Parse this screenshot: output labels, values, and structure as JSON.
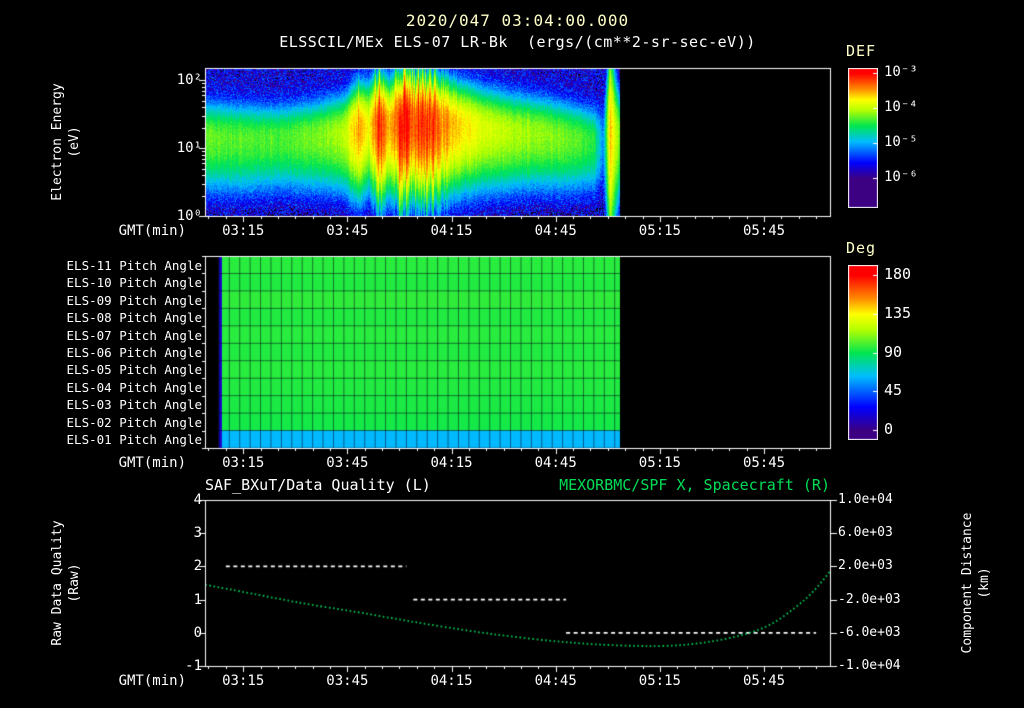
{
  "title": "2020/047 03:04:00.000",
  "colors": {
    "background": "#000000",
    "text": "#ffffff",
    "pale_title": "#ffffc9",
    "green_accent": "#00dd55"
  },
  "time_axis": {
    "label": "GMT(min)",
    "start": "03:04",
    "duration_min": 180,
    "ticks": [
      {
        "label": "03:15",
        "t": 11
      },
      {
        "label": "03:45",
        "t": 41
      },
      {
        "label": "04:15",
        "t": 71
      },
      {
        "label": "04:45",
        "t": 101
      },
      {
        "label": "05:15",
        "t": 131
      },
      {
        "label": "05:45",
        "t": 161
      }
    ]
  },
  "panels": {
    "spectrogram": {
      "title": "ELSSCIL/MEx ELS-07 LR-Bk  (ergs/(cm**2-sr-sec-eV))",
      "ylabel_line1": "Electron Energy",
      "ylabel_line2": "(eV)",
      "ytick_labels": [
        "10²",
        "10¹",
        "10⁰"
      ],
      "colorbar": {
        "title": "DEF",
        "tick_labels": [
          "10⁻³",
          "10⁻⁴",
          "10⁻⁵",
          "10⁻⁶"
        ]
      }
    },
    "pitch": {
      "colorbar": {
        "title": "Deg",
        "tick_labels": [
          "180",
          "135",
          "90",
          "45",
          "0"
        ]
      }
    },
    "timeseries": {
      "title_left": "SAF_BXuT/Data Quality (L)",
      "title_right": "MEXORBMC/SPF X, Spacecraft (R)",
      "ylabel_left_line1": "Raw Data Quality",
      "ylabel_left_line2": "(Raw)",
      "ylabel_right_line1": "Component Distance",
      "ylabel_right_line2": "(km)",
      "ytick_labels_left": [
        "4",
        "3",
        "2",
        "1",
        "0",
        "-1"
      ],
      "ytick_labels_right": [
        "1.0e+04",
        "6.0e+03",
        "2.0e+03",
        "-2.0e+03",
        "-6.0e+03",
        "-1.0e+04"
      ]
    }
  },
  "chart_data": [
    {
      "type": "heatmap",
      "name": "electron-energy-spectrogram",
      "title": "ELSSCIL/MEx ELS-07 LR-Bk",
      "units": "ergs/(cm**2-sr-sec-eV)",
      "x_start": "03:04",
      "x_end": "06:04",
      "data_start_min": 0,
      "data_end_min": 119.5,
      "y_scale": "log",
      "y_range_ev": [
        1,
        151
      ],
      "y_top_log10_ev": 2.18,
      "y_tick_log10": [
        2,
        1,
        0
      ],
      "color_scale": "log",
      "color_log_range": [
        -6,
        -3
      ],
      "colorbar_tick_log10": [
        -3,
        -4,
        -5,
        -6
      ],
      "background_flux": 1.6e-06,
      "black_below": 8e-07,
      "colormap_stops": [
        [
          0.0,
          [
            60,
            0,
            130
          ]
        ],
        [
          0.15,
          [
            0,
            0,
            255
          ]
        ],
        [
          0.35,
          [
            0,
            190,
            255
          ]
        ],
        [
          0.5,
          [
            0,
            230,
            80
          ]
        ],
        [
          0.65,
          [
            180,
            255,
            0
          ]
        ],
        [
          0.75,
          [
            255,
            255,
            0
          ]
        ],
        [
          0.85,
          [
            255,
            140,
            0
          ]
        ],
        [
          1.0,
          [
            255,
            0,
            0
          ]
        ]
      ],
      "band_profile": [
        {
          "t": 0,
          "center_ev": 15,
          "width_dec": 0.27,
          "flux": 5.5e-05
        },
        {
          "t": 10,
          "center_ev": 14,
          "width_dec": 0.27,
          "flux": 5e-05
        },
        {
          "t": 20,
          "center_ev": 14,
          "width_dec": 0.26,
          "flux": 4.5e-05
        },
        {
          "t": 30,
          "center_ev": 15,
          "width_dec": 0.27,
          "flux": 5.5e-05
        },
        {
          "t": 40,
          "center_ev": 17,
          "width_dec": 0.28,
          "flux": 9e-05
        },
        {
          "t": 44,
          "center_ev": 20,
          "width_dec": 0.31,
          "flux": 0.00035
        },
        {
          "t": 47,
          "center_ev": 22,
          "width_dec": 0.3,
          "flux": 0.00016
        },
        {
          "t": 50,
          "center_ev": 25,
          "width_dec": 0.33,
          "flux": 0.0007
        },
        {
          "t": 53,
          "center_ev": 23,
          "width_dec": 0.31,
          "flux": 0.00025
        },
        {
          "t": 56,
          "center_ev": 26,
          "width_dec": 0.34,
          "flux": 0.00095
        },
        {
          "t": 60,
          "center_ev": 25,
          "width_dec": 0.33,
          "flux": 0.0006
        },
        {
          "t": 64,
          "center_ev": 24,
          "width_dec": 0.33,
          "flux": 0.00075
        },
        {
          "t": 68,
          "center_ev": 23,
          "width_dec": 0.32,
          "flux": 0.0004
        },
        {
          "t": 73,
          "center_ev": 22,
          "width_dec": 0.3,
          "flux": 0.00022
        },
        {
          "t": 80,
          "center_ev": 20,
          "width_dec": 0.29,
          "flux": 0.00013
        },
        {
          "t": 88,
          "center_ev": 18,
          "width_dec": 0.28,
          "flux": 9e-05
        },
        {
          "t": 96,
          "center_ev": 17,
          "width_dec": 0.27,
          "flux": 7e-05
        },
        {
          "t": 103,
          "center_ev": 15,
          "width_dec": 0.27,
          "flux": 6e-05
        },
        {
          "t": 108,
          "center_ev": 14,
          "width_dec": 0.26,
          "flux": 5e-05
        },
        {
          "t": 112,
          "center_ev": 13,
          "width_dec": 0.26,
          "flux": 3.5e-05
        },
        {
          "t": 114.5,
          "center_ev": 13,
          "width_dec": 0.3,
          "flux": 5e-06
        },
        {
          "t": 116.5,
          "center_ev": 20,
          "width_dec": 0.6,
          "flux": 0.0003
        },
        {
          "t": 118.5,
          "center_ev": 16,
          "width_dec": 0.38,
          "flux": 8e-05
        },
        {
          "t": 119.5,
          "center_ev": 15,
          "width_dec": 0.3,
          "flux": 5e-05
        }
      ]
    },
    {
      "type": "heatmap",
      "name": "pitch-angle-panel",
      "value_units": "deg",
      "color_range_deg": [
        0,
        180
      ],
      "colorbar_ticks_deg": [
        180,
        135,
        90,
        45,
        0
      ],
      "data_start_min": 4,
      "data_end_min": 119.5,
      "grid_interval_min": 3,
      "left_edge_value_deg": 15,
      "rows": [
        {
          "label": "ELS-11 Pitch Angle",
          "value_deg": 96
        },
        {
          "label": "ELS-10 Pitch Angle",
          "value_deg": 95
        },
        {
          "label": "ELS-09 Pitch Angle",
          "value_deg": 97
        },
        {
          "label": "ELS-08 Pitch Angle",
          "value_deg": 95
        },
        {
          "label": "ELS-07 Pitch Angle",
          "value_deg": 96
        },
        {
          "label": "ELS-06 Pitch Angle",
          "value_deg": 95
        },
        {
          "label": "ELS-05 Pitch Angle",
          "value_deg": 96
        },
        {
          "label": "ELS-04 Pitch Angle",
          "value_deg": 95
        },
        {
          "label": "ELS-03 Pitch Angle",
          "value_deg": 94
        },
        {
          "label": "ELS-02 Pitch Angle",
          "value_deg": 93
        },
        {
          "label": "ELS-01 Pitch Angle",
          "value_deg": 62
        }
      ]
    },
    {
      "type": "line",
      "name": "data-quality-and-spacecraft-distance",
      "x_start": "03:04",
      "duration_min": 180,
      "ylim_left": [
        -1,
        4
      ],
      "ylim_right_km": [
        -10000,
        10000
      ],
      "series": [
        {
          "name": "SAF_BXuT/Data Quality (L)",
          "axis": "left",
          "style": "dashed",
          "color": "#ffffff",
          "segments": [
            {
              "t0": 6,
              "t1": 58,
              "value": 2
            },
            {
              "t0": 60,
              "t1": 104,
              "value": 1
            },
            {
              "t0": 104,
              "t1": 176,
              "value": 0
            }
          ]
        },
        {
          "name": "MEXORBMC/SPF X, Spacecraft (R)",
          "axis": "right",
          "style": "dotted",
          "color": "#00cc55",
          "points_t_km": [
            [
              0,
              -200
            ],
            [
              10,
              -1000
            ],
            [
              20,
              -1800
            ],
            [
              30,
              -2600
            ],
            [
              41,
              -3300
            ],
            [
              52,
              -4100
            ],
            [
              63,
              -4900
            ],
            [
              75,
              -5700
            ],
            [
              87,
              -6400
            ],
            [
              100,
              -7000
            ],
            [
              112,
              -7400
            ],
            [
              124,
              -7600
            ],
            [
              135,
              -7600
            ],
            [
              145,
              -7150
            ],
            [
              155,
              -6300
            ],
            [
              163,
              -5100
            ],
            [
              170,
              -3000
            ],
            [
              175,
              -1200
            ],
            [
              180,
              1400
            ]
          ]
        }
      ]
    }
  ]
}
